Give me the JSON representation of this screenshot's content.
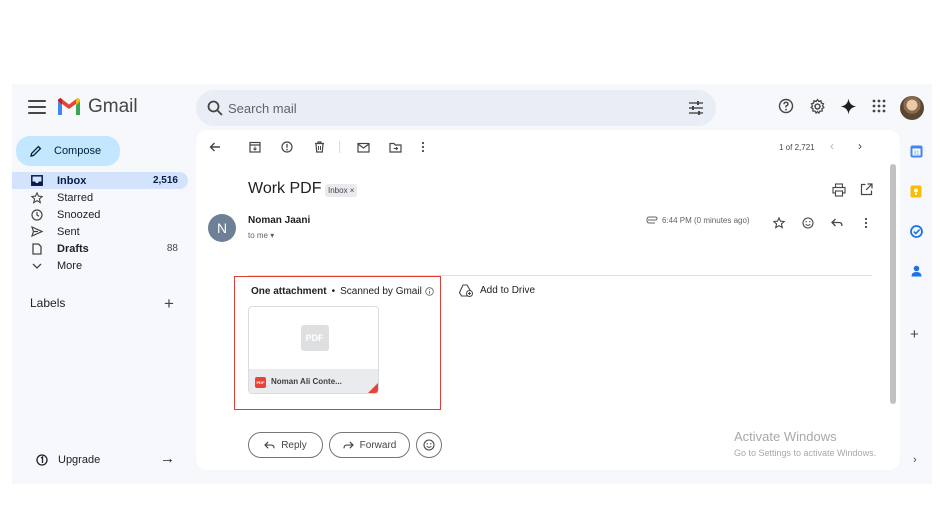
{
  "header": {
    "app_name": "Gmail",
    "search_placeholder": "Search mail"
  },
  "sidebar": {
    "compose_label": "Compose",
    "items": [
      {
        "label": "Inbox",
        "count": "2,516"
      },
      {
        "label": "Starred",
        "count": ""
      },
      {
        "label": "Snoozed",
        "count": ""
      },
      {
        "label": "Sent",
        "count": ""
      },
      {
        "label": "Drafts",
        "count": "88"
      },
      {
        "label": "More",
        "count": ""
      }
    ],
    "labels_heading": "Labels",
    "upgrade_label": "Upgrade"
  },
  "toolbar": {
    "pager": "1 of 2,721"
  },
  "message": {
    "subject": "Work PDF",
    "label_chip": "Inbox ×",
    "sender_initial": "N",
    "sender_name": "Noman Jaani",
    "recipient": "to me ▾",
    "time": "6:44 PM (0 minutes ago)"
  },
  "attachments": {
    "header_count": "One attachment",
    "separator": "•",
    "scanned": "Scanned by Gmail",
    "add_to_drive": "Add to Drive",
    "preview_label": "PDF",
    "file_type_badge": "PDF",
    "file_name": "Noman Ali Conte..."
  },
  "actions": {
    "reply": "Reply",
    "forward": "Forward"
  },
  "watermark": {
    "title": "Activate Windows",
    "subtitle": "Go to Settings to activate Windows."
  },
  "colors": {
    "accent_compose": "#c2e7ff",
    "active_nav": "#d3e3fd",
    "highlight_border": "#e03c31",
    "pdf_red": "#ea4335"
  }
}
